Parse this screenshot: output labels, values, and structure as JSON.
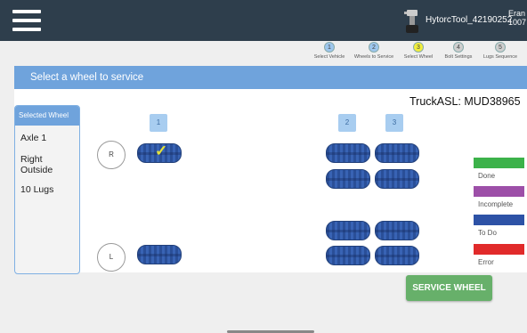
{
  "header": {
    "menu_icon": "hamburger-menu-icon",
    "tool_icon": "torque-wrench-icon",
    "tool_name": "HytorcTool_42190252",
    "user_line1": "Eran",
    "user_line2": "1007"
  },
  "steps": [
    {
      "number": "1",
      "label": "Select Vehicle",
      "color": "#9ec7ee"
    },
    {
      "number": "2",
      "label": "Wheels to Service",
      "color": "#9ec7ee"
    },
    {
      "number": "3",
      "label": "Select Wheel",
      "color": "#f2ef3c"
    },
    {
      "number": "4",
      "label": "Bolt Settings",
      "color": "#cfcfcf"
    },
    {
      "number": "5",
      "label": "Lugs Sequence",
      "color": "#cfcfcf"
    }
  ],
  "title": "Select a wheel to service",
  "selected_wheel": {
    "header": "Selected Wheel",
    "axle": "Axle 1",
    "position_line1": "Right",
    "position_line2": "Outside",
    "lugs": "10 Lugs"
  },
  "truck_label": "TruckASL: MUD38965",
  "axles": [
    "1",
    "2",
    "3"
  ],
  "sides": [
    "R",
    "L"
  ],
  "legend": [
    {
      "label": "Done",
      "color": "#3cb24a"
    },
    {
      "label": "Incomplete",
      "color": "#9d4fa8"
    },
    {
      "label": "To Do",
      "color": "#2d52a6"
    },
    {
      "label": "Error",
      "color": "#e12a2a"
    }
  ],
  "service_button": "SERVICE WHEEL",
  "check_mark": "✓"
}
